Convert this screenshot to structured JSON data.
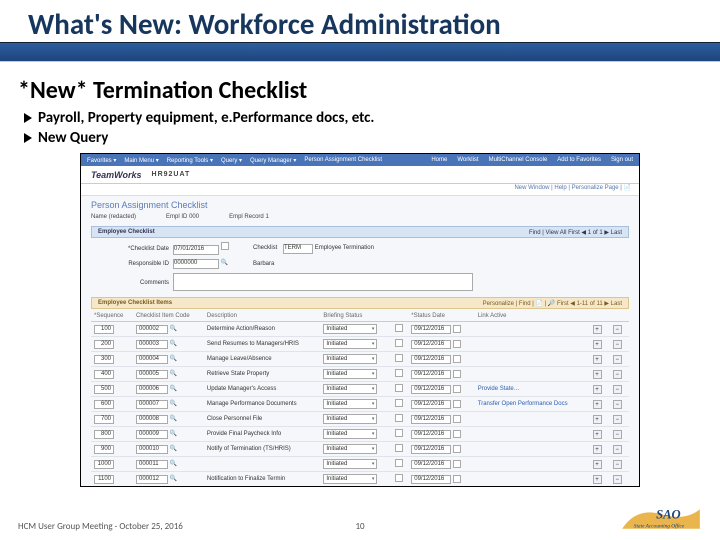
{
  "slide": {
    "title": "What's New: Workforce Administration",
    "subtitle": "*New* Termination Checklist",
    "bullets": [
      "Payroll, Property equipment, e.Performance docs, etc.",
      "New Query"
    ],
    "footer_left": "HCM User Group Meeting - October 25, 2016",
    "page_number": "10",
    "logo_text_top": "SAO",
    "logo_text_bottom": "State Accounting Office"
  },
  "app": {
    "nav_left": [
      "Favorites ▾",
      "Main Menu ▾",
      "Reporting Tools ▾",
      "Query ▾",
      "Query Manager ▾",
      "Person Assignment Checklist"
    ],
    "nav_right": [
      "Home",
      "Worklist",
      "MultiChannel Console",
      "Add to Favorites",
      "Sign out"
    ],
    "brand": "TeamWorks",
    "env": "HR92UAT",
    "tool_links": "New Window | Help | Personalize Page | 📄",
    "page_title": "Person Assignment Checklist",
    "emp_name_label": "Name",
    "emp_name_value": "(redacted)",
    "empid_label": "Empl ID",
    "empid_value": "000",
    "emplrcd_label": "Empl Record",
    "emplrcd_value": "1"
  },
  "empchk": {
    "bar_label": "Employee Checklist",
    "bar_right": "Find | View All   First ◀ 1 of 1 ▶ Last",
    "eff_label": "*Checklist Date",
    "eff_value": "07/01/2016",
    "chk_label": "Checklist",
    "chk_value": "TERM",
    "chk_desc": "Employee Termination",
    "resp_label": "Responsible ID",
    "resp_value": "0000000",
    "resp_lookup": "🔍",
    "resp_name": "Barbara",
    "comm_label": "Comments"
  },
  "items": {
    "bar_label": "Employee Checklist Items",
    "bar_right": "Personalize | Find | 📄 | 🔎   First ◀ 1-11 of 11 ▶ Last",
    "headers": [
      "*Sequence",
      "Checklist Item Code",
      "Description",
      "Briefing Status",
      "",
      "*Status Date",
      "Link Active",
      "",
      "",
      ""
    ],
    "rows": [
      {
        "seq": "100",
        "code": "000002",
        "desc": "Determine Action/Reason",
        "status": "Initiated",
        "date": "09/12/2016",
        "link": ""
      },
      {
        "seq": "200",
        "code": "000003",
        "desc": "Send Resumes to Managers/HRIS",
        "status": "Initiated",
        "date": "09/12/2016",
        "link": ""
      },
      {
        "seq": "300",
        "code": "000004",
        "desc": "Manage Leave/Absence",
        "status": "Initiated",
        "date": "09/12/2016",
        "link": ""
      },
      {
        "seq": "400",
        "code": "000005",
        "desc": "Retrieve State Property",
        "status": "Initiated",
        "date": "09/12/2016",
        "link": ""
      },
      {
        "seq": "500",
        "code": "000006",
        "desc": "Update Manager's Access",
        "status": "Initiated",
        "date": "09/12/2016",
        "link": "Provide State…"
      },
      {
        "seq": "600",
        "code": "000007",
        "desc": "Manage Performance Documents",
        "status": "Initiated",
        "date": "09/12/2016",
        "link": "Transfer Open Performance Docs"
      },
      {
        "seq": "700",
        "code": "000008",
        "desc": "Close Personnel File",
        "status": "Initiated",
        "date": "09/12/2016",
        "link": ""
      },
      {
        "seq": "800",
        "code": "000009",
        "desc": "Provide Final Paycheck Info",
        "status": "Initiated",
        "date": "09/12/2016",
        "link": ""
      },
      {
        "seq": "900",
        "code": "000010",
        "desc": "Notify of Termination (TS/HRIS)",
        "status": "Initiated",
        "date": "09/12/2016",
        "link": ""
      },
      {
        "seq": "1000",
        "code": "000011",
        "desc": "",
        "status": "Initiated",
        "date": "09/12/2016",
        "link": ""
      },
      {
        "seq": "1100",
        "code": "000012",
        "desc": "Notification to Finalize Termin",
        "status": "Initiated",
        "date": "09/12/2016",
        "link": ""
      }
    ]
  }
}
